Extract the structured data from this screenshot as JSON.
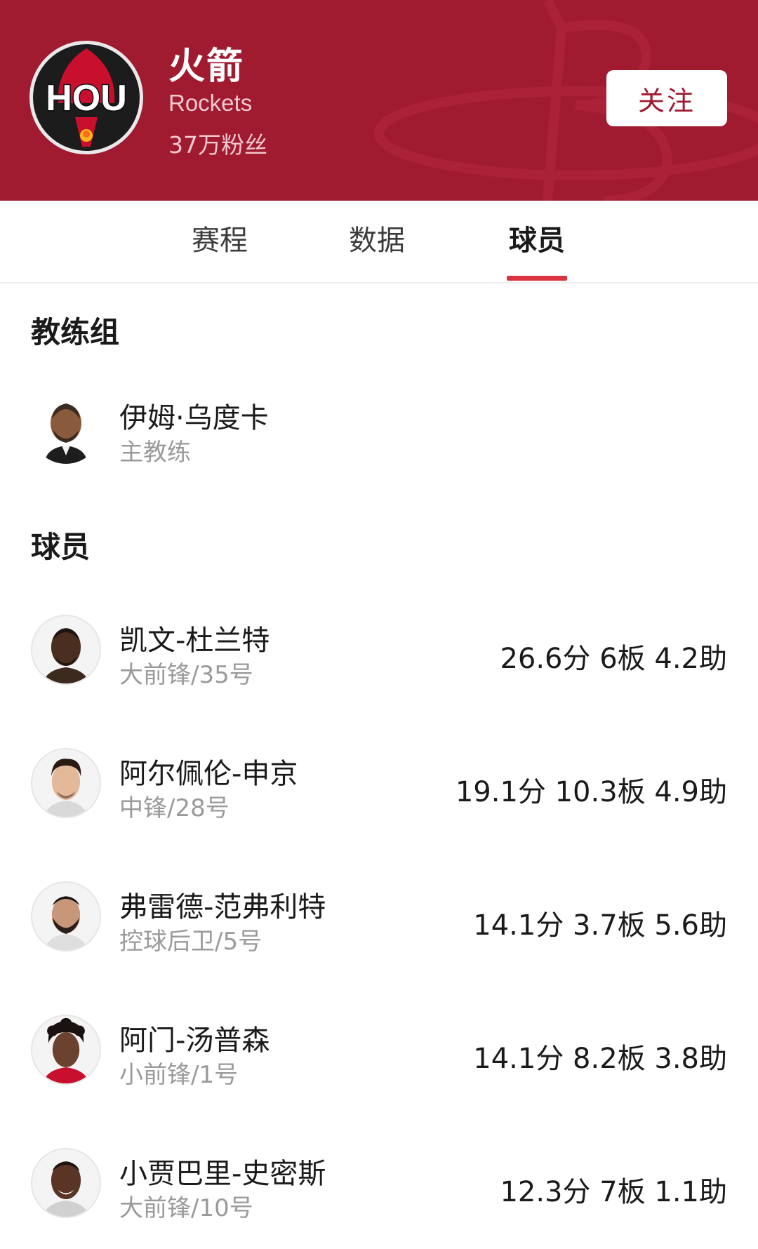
{
  "team": {
    "logo_text": "HOU",
    "name_cn": "火箭",
    "name_en": "Rockets",
    "fans": "37万粉丝",
    "follow_label": "关注",
    "brand_color": "#a01a30"
  },
  "tabs": [
    {
      "label": "赛程",
      "active": false
    },
    {
      "label": "数据",
      "active": false
    },
    {
      "label": "球员",
      "active": true
    }
  ],
  "coaches": {
    "title": "教练组",
    "items": [
      {
        "name": "伊姆·乌度卡",
        "role": "主教练"
      }
    ]
  },
  "players": {
    "title": "球员",
    "items": [
      {
        "name": "凯文-杜兰特",
        "position": "大前锋/35号",
        "stats": "26.6分 6板 4.2助"
      },
      {
        "name": "阿尔佩伦-申京",
        "position": "中锋/28号",
        "stats": "19.1分 10.3板 4.9助"
      },
      {
        "name": "弗雷德-范弗利特",
        "position": "控球后卫/5号",
        "stats": "14.1分 3.7板 5.6助"
      },
      {
        "name": "阿门-汤普森",
        "position": "小前锋/1号",
        "stats": "14.1分 8.2板 3.8助"
      },
      {
        "name": "小贾巴里-史密斯",
        "position": "大前锋/10号",
        "stats": "12.3分 7板 1.1助"
      }
    ]
  }
}
